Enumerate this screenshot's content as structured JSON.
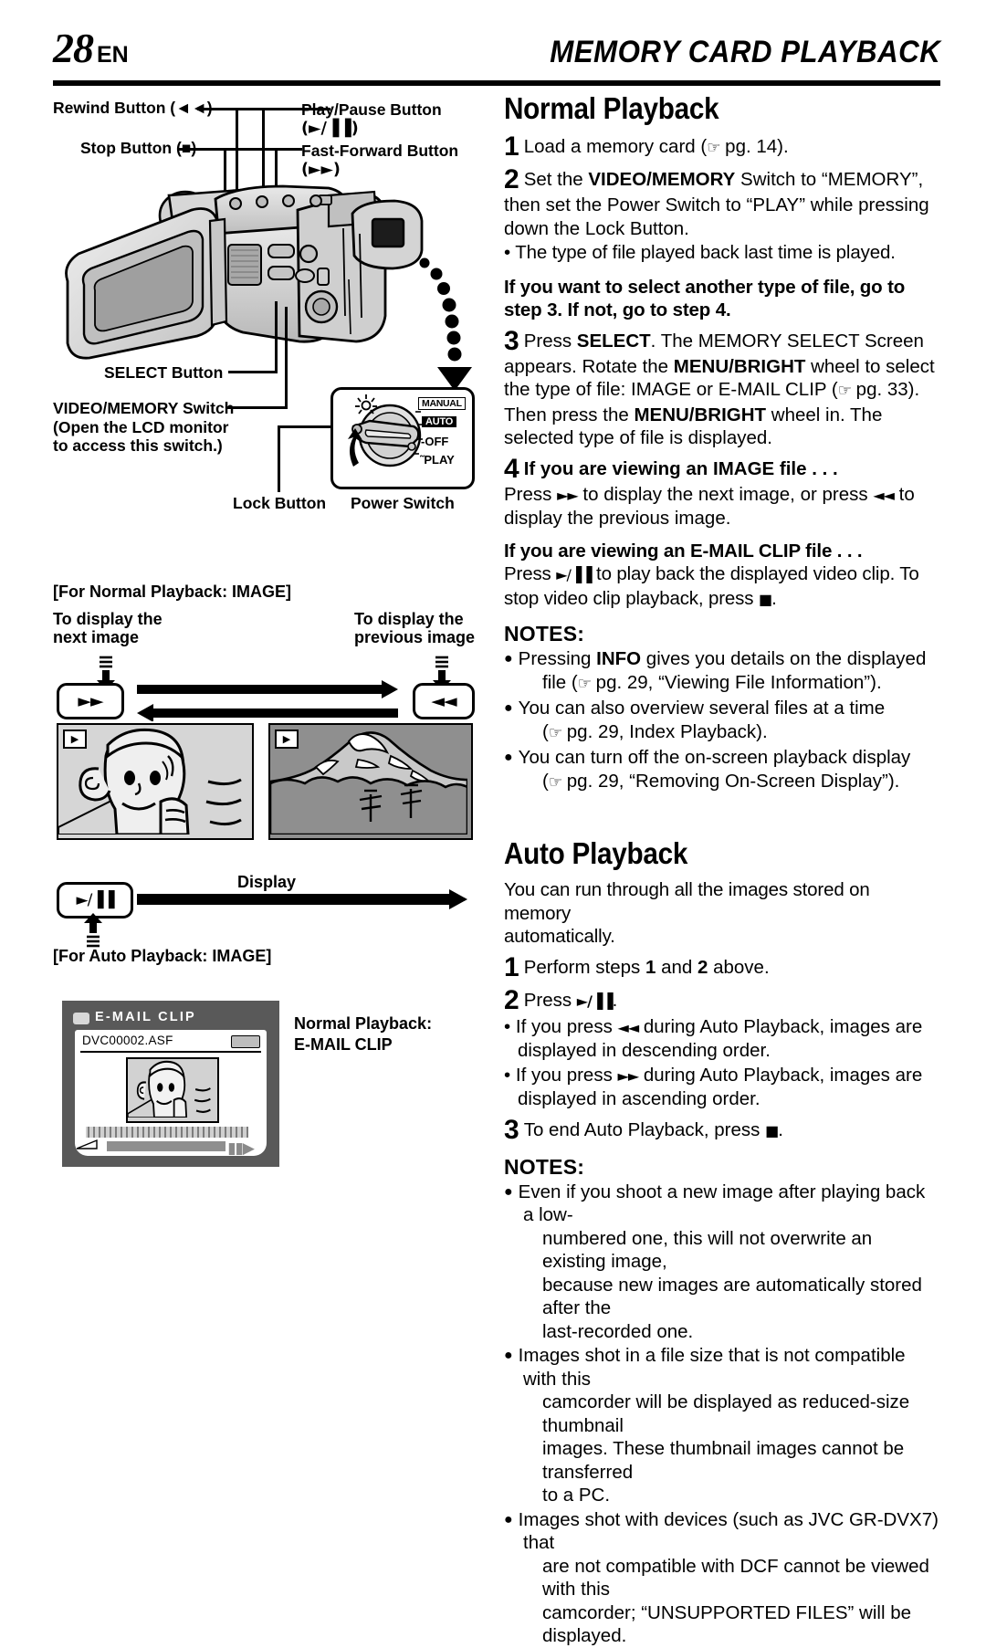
{
  "header": {
    "page_number": "28",
    "lang": "EN",
    "chapter_title": "MEMORY CARD PLAYBACK"
  },
  "diagram": {
    "labels": {
      "rewind_button": "Rewind Button (◄◄)",
      "stop_button": "Stop Button (■)",
      "play_pause_button": "Play/Pause Button",
      "play_pause_symbol": "(►/▐▐)",
      "fast_forward_button": "Fast-Forward Button",
      "fast_forward_symbol": "(►►)",
      "select_button": "SELECT Button",
      "video_memory_switch": "VIDEO/MEMORY Switch",
      "video_memory_note_1": "(Open the LCD monitor",
      "video_memory_note_2": "to access this switch.)",
      "lock_button": "Lock Button",
      "power_switch": "Power Switch"
    },
    "power_switch_positions": [
      "MANUAL",
      "AUTO",
      "-OFF",
      "˜PLAY"
    ],
    "power_switch_highlighted": "AUTO"
  },
  "normal_playback_figure": {
    "caption": "[For Normal Playback: IMAGE]",
    "left_label_line1": "To display the",
    "left_label_line2": "next image",
    "right_label_line1": "To display the",
    "right_label_line2": "previous image",
    "next_button": "►►",
    "prev_button": "◄◄",
    "display_label": "Display",
    "play_pause_button": "►/▐▐",
    "auto_caption": "[For Auto Playback: IMAGE]"
  },
  "email_clip_figure": {
    "screen_title": "E-MAIL CLIP",
    "file_name": "DVC00002.ASF",
    "caption_line1": "Normal Playback:",
    "caption_line2": "E-MAIL CLIP"
  },
  "normal_playback": {
    "title": "Normal Playback",
    "step1_num": "1",
    "step1_text_a": "Load a memory card (",
    "step1_pg": " pg. 14).",
    "step2_num": "2",
    "step2_a": "Set the ",
    "step2_b": "VIDEO/MEMORY",
    "step2_c": " Switch to “MEMORY”,",
    "step2_l2": "then set the Power Switch to “PLAY” while pressing",
    "step2_l3": "down the Lock Button.",
    "step2_bullet": "• The type of file played back last time is played.",
    "note_bold_l1": "If you want to select another type of file, go to",
    "note_bold_l2": "step 3. If not, go to step 4.",
    "step3_num": "3",
    "step3_a": "Press ",
    "step3_b": "SELECT",
    "step3_c": ". The MEMORY SELECT Screen",
    "step3_l2a": "appears. Rotate the ",
    "step3_l2b": "MENU/BRIGHT",
    "step3_l2c": " wheel to select",
    "step3_l3a": "the type of file: IMAGE or E-MAIL CLIP (",
    "step3_l3b": " pg. 33).",
    "step3_l4a": "Then press the ",
    "step3_l4b": "MENU/BRIGHT",
    "step3_l4c": " wheel in. The",
    "step3_l5": "selected type of file is displayed.",
    "step4_num": "4",
    "step4_heading": "If you are viewing an IMAGE file . . .",
    "step4_l1a": "Press ",
    "step4_l1b": "►►",
    "step4_l1c": " to display the next image, or press ",
    "step4_l1d": "◄◄",
    "step4_l1e": " to",
    "step4_l2": "display the previous image.",
    "email_heading": "If you are viewing an E-MAIL CLIP file . . .",
    "email_l1a": "Press ",
    "email_l1b": "►/▐▐",
    "email_l1c": " to play back the displayed video clip. To",
    "email_l2a": "stop video clip playback, press ",
    "email_l2b": "■",
    "email_l2c": ".",
    "notes_title": "NOTES:",
    "notes": [
      {
        "a": "Pressing ",
        "b": "INFO",
        "c": " gives you details on the displayed",
        "l2a": "file (",
        "l2b": " pg. 29, “Viewing File Information”)."
      },
      {
        "a": "You can also overview several files at a time",
        "b": "",
        "c": "",
        "l2a": "(",
        "l2b": " pg. 29, Index Playback)."
      },
      {
        "a": "You can turn off the on-screen playback display",
        "b": "",
        "c": "",
        "l2a": "(",
        "l2b": " pg. 29, “Removing On-Screen Display”)."
      }
    ]
  },
  "auto_playback": {
    "title": "Auto Playback",
    "intro_l1": "You can run through all the images stored on memory",
    "intro_l2": "automatically.",
    "step1_num": "1",
    "step1_a": "Perform steps ",
    "step1_b": "1",
    "step1_c": " and ",
    "step1_d": "2",
    "step1_e": " above.",
    "step2_num": "2",
    "step2_a": "Press ",
    "step2_b": "►/▐▐",
    "step2_c": ".",
    "bullet1_a": "• If you press ",
    "bullet1_b": "◄◄",
    "bullet1_c": " during Auto Playback, images are",
    "bullet1_l2": "displayed in descending order.",
    "bullet2_a": "• If you press ",
    "bullet2_b": "►►",
    "bullet2_c": " during Auto Playback, images are",
    "bullet2_l2": "displayed in ascending order.",
    "step3_num": "3",
    "step3_a": "To end Auto Playback, press ",
    "step3_b": "■",
    "step3_c": ".",
    "notes_title": "NOTES:",
    "note1_l1": "Even if you shoot a new image after playing back a low-",
    "note1_l2": "numbered one, this will not overwrite an existing image,",
    "note1_l3": "because new images are automatically stored after the",
    "note1_l4": "last-recorded one.",
    "note2_l1": "Images shot in a file size that is not compatible with this",
    "note2_l2": "camcorder will be displayed as reduced-size thumbnail",
    "note2_l3": "images. These thumbnail images cannot be transferred",
    "note2_l4": "to a PC.",
    "note3_l1": "Images shot with devices (such as JVC GR-DVX7) that",
    "note3_l2": "are not compatible with DCF cannot be viewed with this",
    "note3_l3": "camcorder; “UNSUPPORTED FILES” will be displayed."
  }
}
